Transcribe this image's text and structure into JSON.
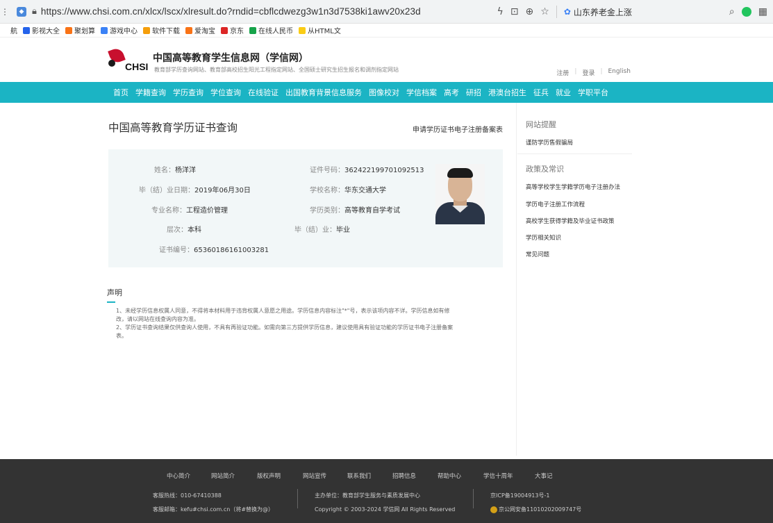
{
  "browser": {
    "url": "https://www.chsi.com.cn/xlcx/lscx/xlresult.do?rndid=cbflcdwezg3w1n3d7538ki1awv20x23d",
    "weibo_text": "山东养老金上涨"
  },
  "bookmarks": [
    {
      "label": "航",
      "color": "#ffffff"
    },
    {
      "label": "影视大全",
      "color": "#2563eb"
    },
    {
      "label": "聚划算",
      "color": "#f97316"
    },
    {
      "label": "游戏中心",
      "color": "#3b82f6"
    },
    {
      "label": "软件下载",
      "color": "#f59e0b"
    },
    {
      "label": "爱淘宝",
      "color": "#f97316"
    },
    {
      "label": "京东",
      "color": "#dc2626"
    },
    {
      "label": "在线人民币",
      "color": "#16a34a"
    },
    {
      "label": "从HTML文",
      "color": "#facc15"
    }
  ],
  "header": {
    "title": "中国高等教育学生信息网（学信网）",
    "logo_en": "CHSI",
    "subtitle": "教育部学历查询网站、教育部高校招生阳光工程指定网站、全国硕士研究生招生报名和调剂指定网站",
    "links": [
      "注册",
      "登录",
      "English"
    ]
  },
  "nav": [
    "首页",
    "学籍查询",
    "学历查询",
    "学位查询",
    "在线验证",
    "出国教育背景信息服务",
    "图像校对",
    "学信档案",
    "高考",
    "研招",
    "港澳台招生",
    "征兵",
    "就业",
    "学职平台"
  ],
  "main": {
    "page_title": "中国高等教育学历证书查询",
    "apply_link": "申请学历证书电子注册备案表",
    "fields": {
      "name_label": "姓名：",
      "name": "杨洋洋",
      "id_label": "证件号码：",
      "id": "362422199701092513",
      "grad_date_label": "毕（结）业日期：",
      "grad_date": "2019年06月30日",
      "school_label": "学校名称：",
      "school": "华东交通大学",
      "major_label": "专业名称：",
      "major": "工程造价管理",
      "type_label": "学历类别：",
      "type": "高等教育自学考试",
      "level_label": "层次：",
      "level": "本科",
      "status_label": "毕（结）业：",
      "status": "毕业",
      "cert_label": "证书编号：",
      "cert": "65360186161003281"
    }
  },
  "declaration": {
    "title": "声明",
    "p1a": "1、未经学历信息权属人同意，不得将本材料用于违背权属人意愿之用途。学历信息内容标注\"*\"号，表示该项内容不详。学历信息如有修",
    "p1b": "改，请以网站在线查询内容为准。",
    "p2a": "2、学历证书查询结果仅供查询人使用，不具有再验证功能。如需向第三方提供学历信息，建议使用具有验证功能的学历证书电子注册备案",
    "p2b": "表。"
  },
  "sidebar": {
    "reminder_title": "网站提醒",
    "reminder_link": "谨防学历售假骗局",
    "policy_title": "政策及常识",
    "policy_links": [
      "高等学校学生学籍学历电子注册办法",
      "学历电子注册工作流程",
      "高校学生获得学籍及毕业证书政策",
      "学历相关知识",
      "常见问题"
    ]
  },
  "footer": {
    "nav": [
      "中心简介",
      "网站简介",
      "版权声明",
      "网站宣传",
      "联系我们",
      "招聘信息",
      "帮助中心",
      "学信十周年",
      "大事记"
    ],
    "hotline": "客服热线：010-67410388",
    "email": "客服邮箱：kefu#chsi.com.cn（将#替换为@）",
    "host": "主办单位：教育部学生服务与素质发展中心",
    "copyright": "Copyright © 2003-2024 学信网 All Rights Reserved",
    "icp": "京ICP备19004913号-1",
    "police": "京公网安备11010202009747号"
  }
}
